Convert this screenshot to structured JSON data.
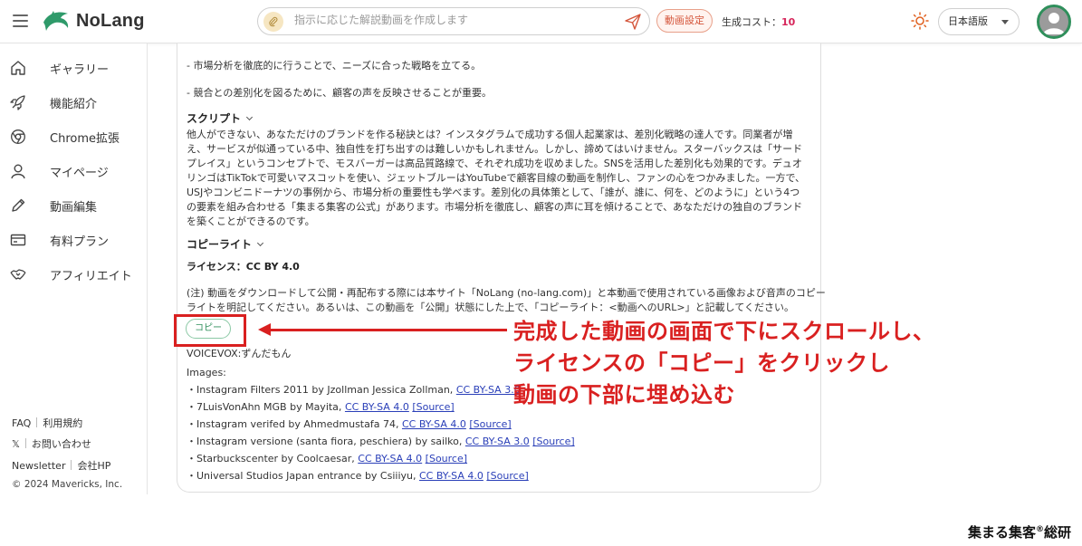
{
  "header": {
    "app_name": "NoLang",
    "prompt_placeholder": "指示に応じた解説動画を作成します",
    "video_settings_label": "動画設定",
    "cost_label": "生成コスト：",
    "cost_value": "10",
    "language": "日本語版"
  },
  "sidebar": {
    "items": [
      {
        "label": "ギャラリー",
        "icon": "home-icon"
      },
      {
        "label": "機能紹介",
        "icon": "rocket-icon"
      },
      {
        "label": "Chrome拡張",
        "icon": "chrome-icon"
      },
      {
        "label": "マイページ",
        "icon": "user-icon"
      },
      {
        "label": "動画編集",
        "icon": "pencil-icon"
      },
      {
        "label": "有料プラン",
        "icon": "card-icon"
      },
      {
        "label": "アフィリエイト",
        "icon": "handshake-icon"
      }
    ],
    "footer": {
      "faq": "FAQ",
      "terms": "利用規約",
      "x": "𝕏",
      "contact": "お問い合わせ",
      "newsletter": "Newsletter",
      "company": "会社HP",
      "copyright": "© 2024 Mavericks, Inc."
    }
  },
  "main": {
    "bullet_1": "- 市場分析を徹底的に行うことで、ニーズに合った戦略を立てる。",
    "bullet_2": "- 競合との差別化を図るために、顧客の声を反映させることが重要。",
    "script_heading": "スクリプト",
    "script_text": "他人ができない、あなただけのブランドを作る秘訣とは？インスタグラムで成功する個人起業家は、差別化戦略の達人です。同業者が増え、サービスが似通っている中、独自性を打ち出すのは難しいかもしれません。しかし、諦めてはいけません。スターバックスは「サードプレイス」というコンセプトで、モスバーガーは高品質路線で、それぞれ成功を収めました。SNSを活用した差別化も効果的です。デュオリンゴはTikTokで可愛いマスコットを使い、ジェットブルーはYouTubeで顧客目線の動画を制作し、ファンの心をつかみました。一方で、USJやコンビニドーナツの事例から、市場分析の重要性も学べます。差別化の具体策として、「誰が、誰に、何を、どのように」という4つの要素を組み合わせる「集まる集客の公式」があります。市場分析を徹底し、顧客の声に耳を傾けることで、あなただけの独自のブランドを築くことができるのです。",
    "copyright_heading": "コピーライト",
    "license": "ライセンス：CC BY 4.0",
    "notice_1": "(注) 動画をダウンロードして公開・再配布する際には本サイト「NoLang (no-lang.com)」と本動画で使用されている画像および音声のコピー",
    "notice_2": "ライトを明記してください。あるいは、この動画を「公開」状態にした上で、「コピーライト：<動画へのURL>」と記載してください。",
    "copy_button": "コピー",
    "voice_credit": "VOICEVOX:ずんだもん",
    "images_label": "Images:",
    "credits": [
      {
        "text": "・Instagram Filters 2011 by Jzollman Jessica Zollman,",
        "license": "CC BY-SA 3.0",
        "source": ""
      },
      {
        "text": "・7LuisVonAhn MGB by Mayita,",
        "license": "CC BY-SA 4.0",
        "source": "[Source]"
      },
      {
        "text": "・Instagram verifed by Ahmedmustafa 74,",
        "license": "CC BY-SA 4.0",
        "source": "[Source]"
      },
      {
        "text": "・Instagram versione (santa fiora, peschiera) by sailko,",
        "license": "CC BY-SA 3.0",
        "source": "[Source]"
      },
      {
        "text": "・Starbuckscenter by Coolcaesar,",
        "license": "CC BY-SA 4.0",
        "source": "[Source]"
      },
      {
        "text": "・Universal Studios Japan entrance by Csiiiyu,",
        "license": "CC BY-SA 4.0",
        "source": "[Source]"
      }
    ]
  },
  "annotation": {
    "line_1": "完成した動画の画面で下にスクロールし、",
    "line_2": "ライセンスの「コピー」をクリックし",
    "line_3": "動画の下部に埋め込む",
    "brand": "集まる集客",
    "brand_mark": "®",
    "brand_suffix": "総研",
    "color": "#d92020"
  }
}
